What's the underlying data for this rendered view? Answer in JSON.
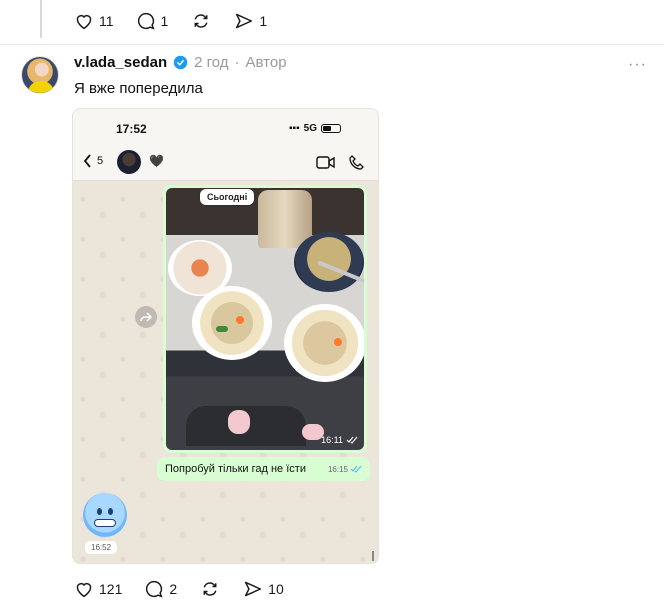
{
  "top_actions": {
    "likes": "11",
    "comments": "1",
    "reposts": "",
    "shares": "1"
  },
  "post": {
    "username": "v.lada_sedan",
    "time": "2 год",
    "separator": "·",
    "role": "Автор",
    "more": "···",
    "text": "Я вже попередила"
  },
  "screenshot": {
    "clock": "17:52",
    "network": "5G",
    "unread_count": "5",
    "heart": "🖤",
    "date_chip": "Сьогодні",
    "photo_time": "16:11",
    "message_text": "Попробуй тільки гад не їсти",
    "message_time": "16:15",
    "emoji_time": "16:52"
  },
  "bottom_actions": {
    "likes": "121",
    "comments": "2",
    "reposts": "",
    "shares": "10"
  },
  "colors": {
    "verified": "#1d9bf0",
    "bubble": "#d9fdd3",
    "read_ticks": "#53bdeb"
  },
  "icons": [
    "heart-icon",
    "comment-icon",
    "repost-icon",
    "share-icon",
    "verified-icon",
    "video-call-icon",
    "phone-icon",
    "forward-icon",
    "back-chevron-icon"
  ]
}
